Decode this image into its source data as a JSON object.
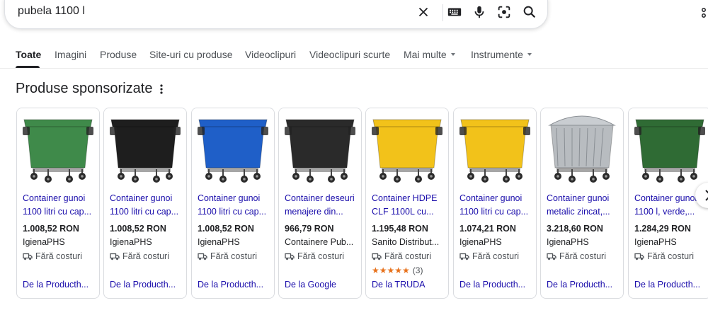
{
  "search": {
    "query": "pubela 1100 l"
  },
  "icons": {
    "clear": "close-icon",
    "keyboard": "keyboard-icon",
    "voice": "microphone-icon",
    "lens": "camera-lens-icon",
    "search": "search-icon",
    "apps": "apps-icon",
    "menu": "more-vert-icon",
    "shipping": "truck-icon",
    "next": "chevron-right-icon"
  },
  "tabs": [
    {
      "label": "Toate"
    },
    {
      "label": "Imagini"
    },
    {
      "label": "Produse"
    },
    {
      "label": "Site-uri cu produse"
    },
    {
      "label": "Videoclipuri"
    },
    {
      "label": "Videoclipuri scurte"
    },
    {
      "label": "Mai multe"
    },
    {
      "label": "Instrumente"
    }
  ],
  "section": {
    "title": "Produse sponsorizate"
  },
  "products": [
    {
      "title1": "Container gunoi",
      "title2": "1100 litri cu cap...",
      "price": "1.008,52 RON",
      "seller": "IgienaPHS",
      "shipping": "Fără costuri",
      "from": "De la Producth...",
      "color": "#3f8a4a"
    },
    {
      "title1": "Container gunoi",
      "title2": "1100 litri cu cap...",
      "price": "1.008,52 RON",
      "seller": "IgienaPHS",
      "shipping": "Fără costuri",
      "from": "De la Producth...",
      "color": "#1e1e1e"
    },
    {
      "title1": "Container gunoi",
      "title2": "1100 litri cu cap...",
      "price": "1.008,52 RON",
      "seller": "IgienaPHS",
      "shipping": "Fără costuri",
      "from": "De la Producth...",
      "color": "#1f5fc8"
    },
    {
      "title1": "Container deseuri",
      "title2": "menajere din...",
      "price": "966,79 RON",
      "seller": "Containere Pub...",
      "shipping": "Fără costuri",
      "from": "De la Google",
      "color": "#2a2a2a"
    },
    {
      "title1": "Container HDPE",
      "title2": "CLF 1100L cu...",
      "price": "1.195,48 RON",
      "seller": "Sanito Distribut...",
      "shipping": "Fără costuri",
      "stars": "★★★★★",
      "rating_count": "(3)",
      "from": "De la TRUDA",
      "color": "#f2c21a"
    },
    {
      "title1": "Container gunoi",
      "title2": "1100 litri cu cap...",
      "price": "1.074,21 RON",
      "seller": "IgienaPHS",
      "shipping": "Fără costuri",
      "from": "De la Producth...",
      "color": "#f2c21a"
    },
    {
      "title1": "Container gunoi",
      "title2": "metalic zincat,...",
      "price": "3.218,60 RON",
      "seller": "IgienaPHS",
      "shipping": "Fără costuri",
      "from": "De la Producth...",
      "color": "#b8bcc0"
    },
    {
      "title1": "Container gunoi",
      "title2": "1100 l, verde,...",
      "price": "1.284,29 RON",
      "seller": "IgienaPHS",
      "shipping": "Fără costuri",
      "from": "De la Producth...",
      "color": "#2f6b34"
    }
  ]
}
